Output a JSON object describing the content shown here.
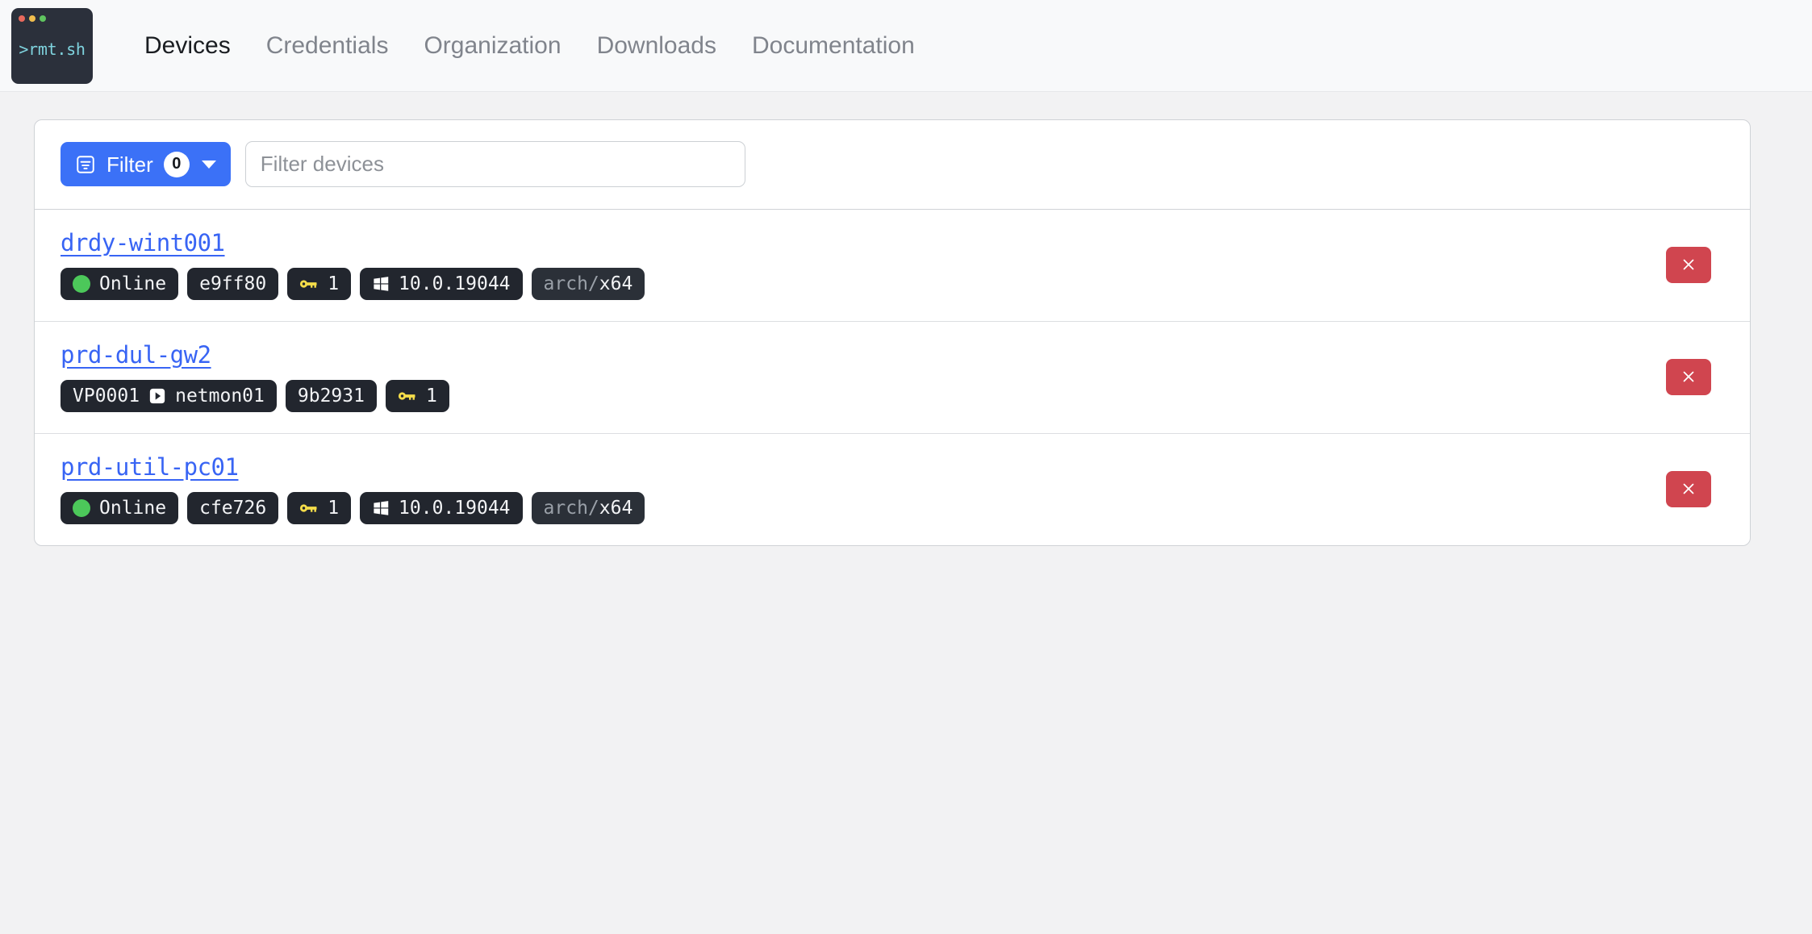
{
  "brand": {
    "text": ">rmt.sh",
    "dots": [
      "red",
      "yellow",
      "green"
    ]
  },
  "nav": {
    "items": [
      {
        "label": "Devices",
        "active": true
      },
      {
        "label": "Credentials",
        "active": false
      },
      {
        "label": "Organization",
        "active": false
      },
      {
        "label": "Downloads",
        "active": false
      },
      {
        "label": "Documentation",
        "active": false
      }
    ]
  },
  "filter_bar": {
    "button_label": "Filter",
    "count": "0",
    "search_placeholder": "Filter devices",
    "search_value": ""
  },
  "devices": [
    {
      "name": "drdy-wint001",
      "status": "Online",
      "id": "e9ff80",
      "keys": "1",
      "os_version": "10.0.19044",
      "arch_prefix": "arch/",
      "arch_value": "x64",
      "delete_label": "×"
    },
    {
      "name": "prd-dul-gw2",
      "route_from": "VP0001",
      "route_to": "netmon01",
      "id": "9b2931",
      "keys": "1",
      "delete_label": "×"
    },
    {
      "name": "prd-util-pc01",
      "status": "Online",
      "id": "cfe726",
      "keys": "1",
      "os_version": "10.0.19044",
      "arch_prefix": "arch/",
      "arch_value": "x64",
      "delete_label": "×"
    }
  ],
  "colors": {
    "accent_blue": "#3b71f7",
    "link_blue": "#3864f4",
    "danger_red": "#d0454f",
    "online_green": "#4cc85a",
    "key_yellow": "#f5dd4a",
    "badge_dark": "#22262e"
  }
}
